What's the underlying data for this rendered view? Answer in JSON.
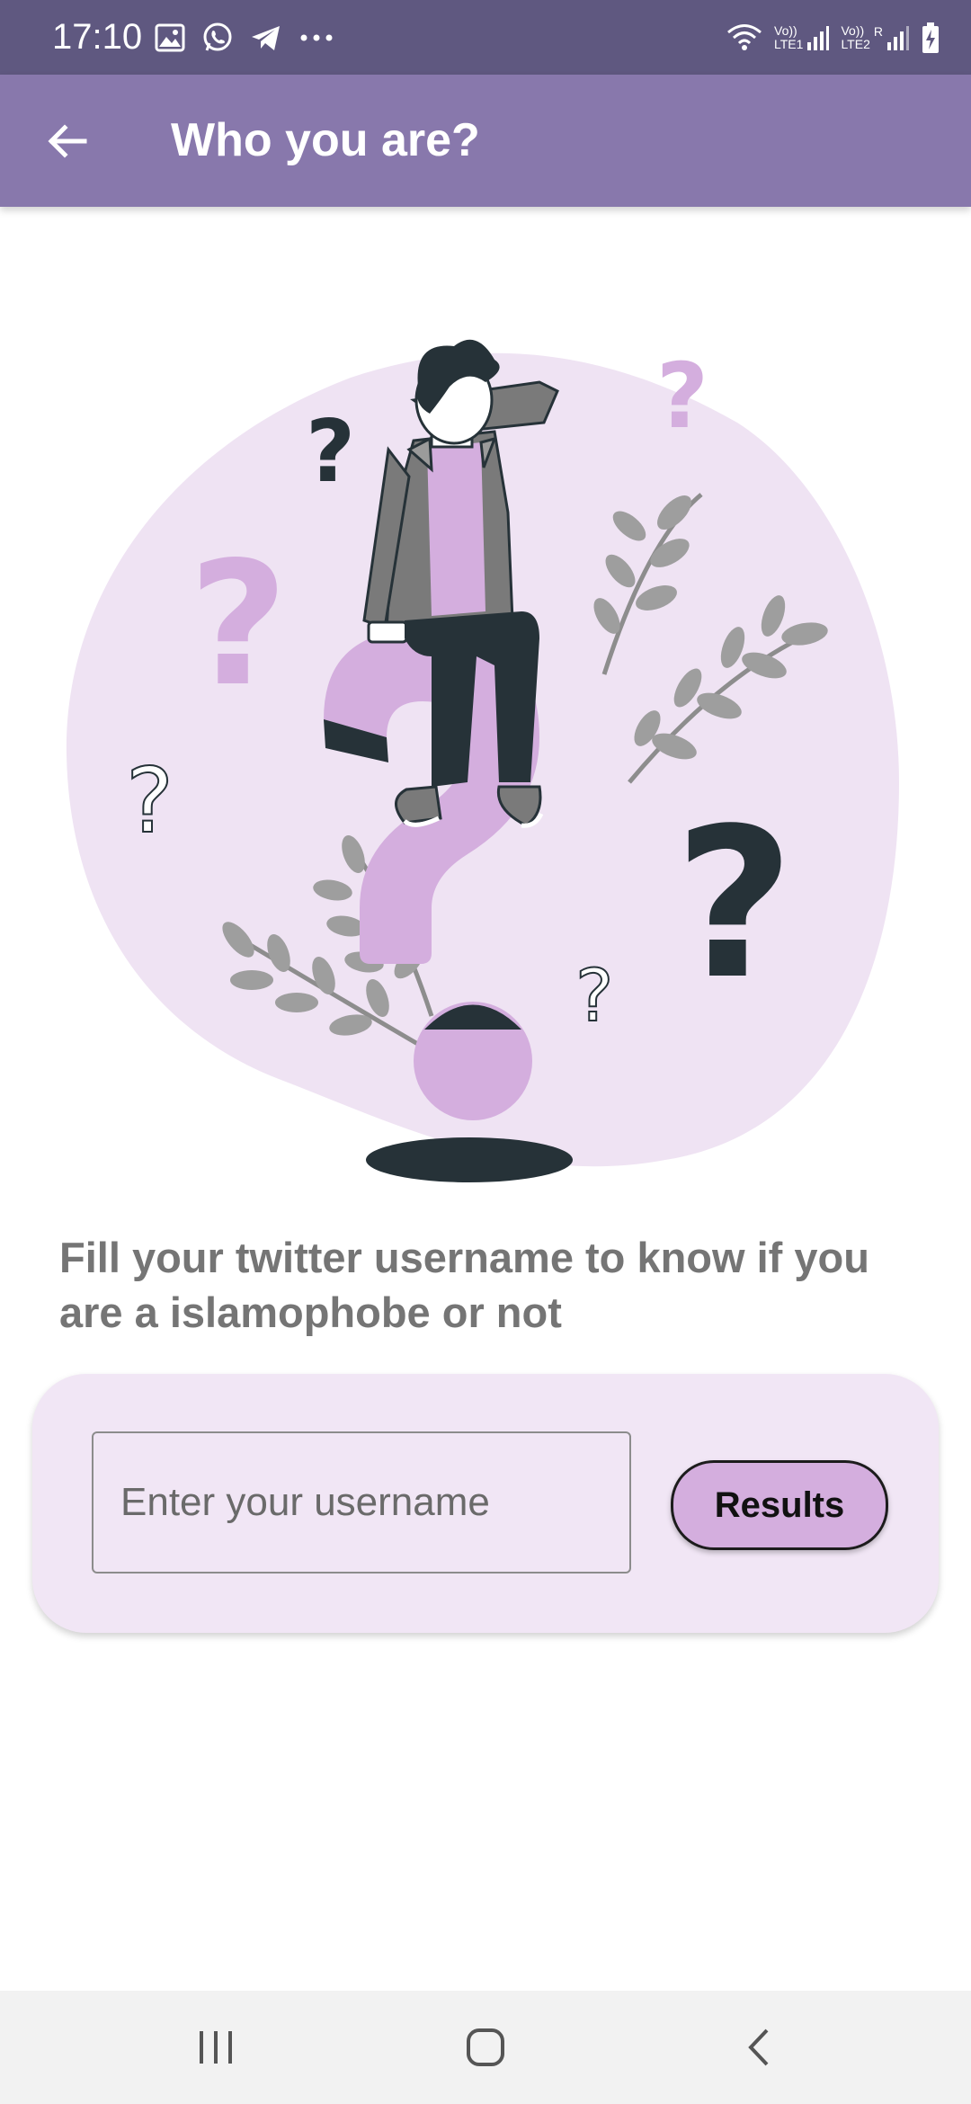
{
  "status_bar": {
    "time": "17:10",
    "left_icons": [
      "image-icon",
      "whatsapp-icon",
      "telegram-icon",
      "more-dots-icon"
    ],
    "right_icons": [
      "wifi-icon",
      "volte-lte1-signal-icon",
      "volte-lte2-signal-icon",
      "battery-charging-icon"
    ],
    "sim1_label": "LTE1",
    "sim2_label": "LTE2",
    "volte_label": "Vo))",
    "roaming_label": "R"
  },
  "app_bar": {
    "title": "Who you are?",
    "back_icon": "arrow-back-icon",
    "color": "#8878ac"
  },
  "illustration": {
    "name": "confused-person-question-marks",
    "colors": {
      "blob": "#efe3f3",
      "accent": "#d4aede",
      "dark": "#263238",
      "leaf": "#9e9e9e"
    }
  },
  "description": "Fill your twitter username to know if you are a islamophobe or not",
  "form": {
    "username_placeholder": "Enter your username",
    "username_value": "",
    "results_label": "Results",
    "card_color": "#f1e6f5",
    "button_color": "#d4aede"
  },
  "nav_bar": {
    "buttons": [
      "recent-apps-icon",
      "home-icon",
      "back-chevron-icon"
    ]
  }
}
